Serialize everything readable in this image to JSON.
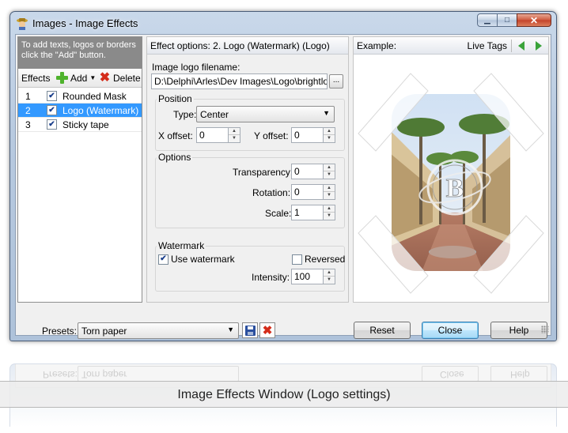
{
  "window": {
    "title": "Images - Image Effects",
    "minimize_glyph": "▁",
    "maximize_glyph": "□",
    "close_glyph": "✕"
  },
  "left_panel": {
    "hint": "To add texts, logos or borders click the \"Add\" button.",
    "effects_label": "Effects",
    "add_label": "Add",
    "delete_label": "Delete",
    "items": [
      {
        "num": "1",
        "name": "Rounded Mask",
        "checked": true,
        "selected": false
      },
      {
        "num": "2",
        "name": "Logo (Watermark)",
        "checked": true,
        "selected": true
      },
      {
        "num": "3",
        "name": "Sticky tape",
        "checked": true,
        "selected": false
      }
    ]
  },
  "options": {
    "header": "Effect options: 2. Logo (Watermark) (Logo)",
    "filename_label": "Image logo filename:",
    "filename_value": "D:\\Delphi\\Arles\\Dev Images\\Logo\\brightlogo.",
    "browse_label": "...",
    "position": {
      "title": "Position",
      "type_label": "Type:",
      "type_value": "Center",
      "x_label": "X offset:",
      "x_value": "0",
      "y_label": "Y offset:",
      "y_value": "0"
    },
    "options_group": {
      "title": "Options",
      "transparency_label": "Transparency:",
      "transparency_value": "0",
      "rotation_label": "Rotation:",
      "rotation_value": "0",
      "scale_label": "Scale:",
      "scale_value": "1"
    },
    "watermark": {
      "title": "Watermark",
      "use_label": "Use watermark",
      "use_checked": true,
      "reversed_label": "Reversed",
      "reversed_checked": false,
      "intensity_label": "Intensity:",
      "intensity_value": "100"
    }
  },
  "example": {
    "label": "Example:",
    "live_tags": "Live Tags",
    "logo_letter": "B"
  },
  "bottom": {
    "presets_label": "Presets:",
    "preset_value": "Torn paper",
    "reset": "Reset",
    "close": "Close",
    "help": "Help"
  },
  "reflection": {
    "presets_label": "Presets:",
    "preset_value": "Torn paper",
    "close": "Close",
    "help": "Help"
  },
  "caption": "Image Effects Window (Logo settings)",
  "colors": {
    "selection": "#3399ff",
    "title_bar": "#b7c9df",
    "hint_bg": "#8a8a8a",
    "close_button": "#c3422a",
    "green_arrow": "#3aa33a"
  }
}
